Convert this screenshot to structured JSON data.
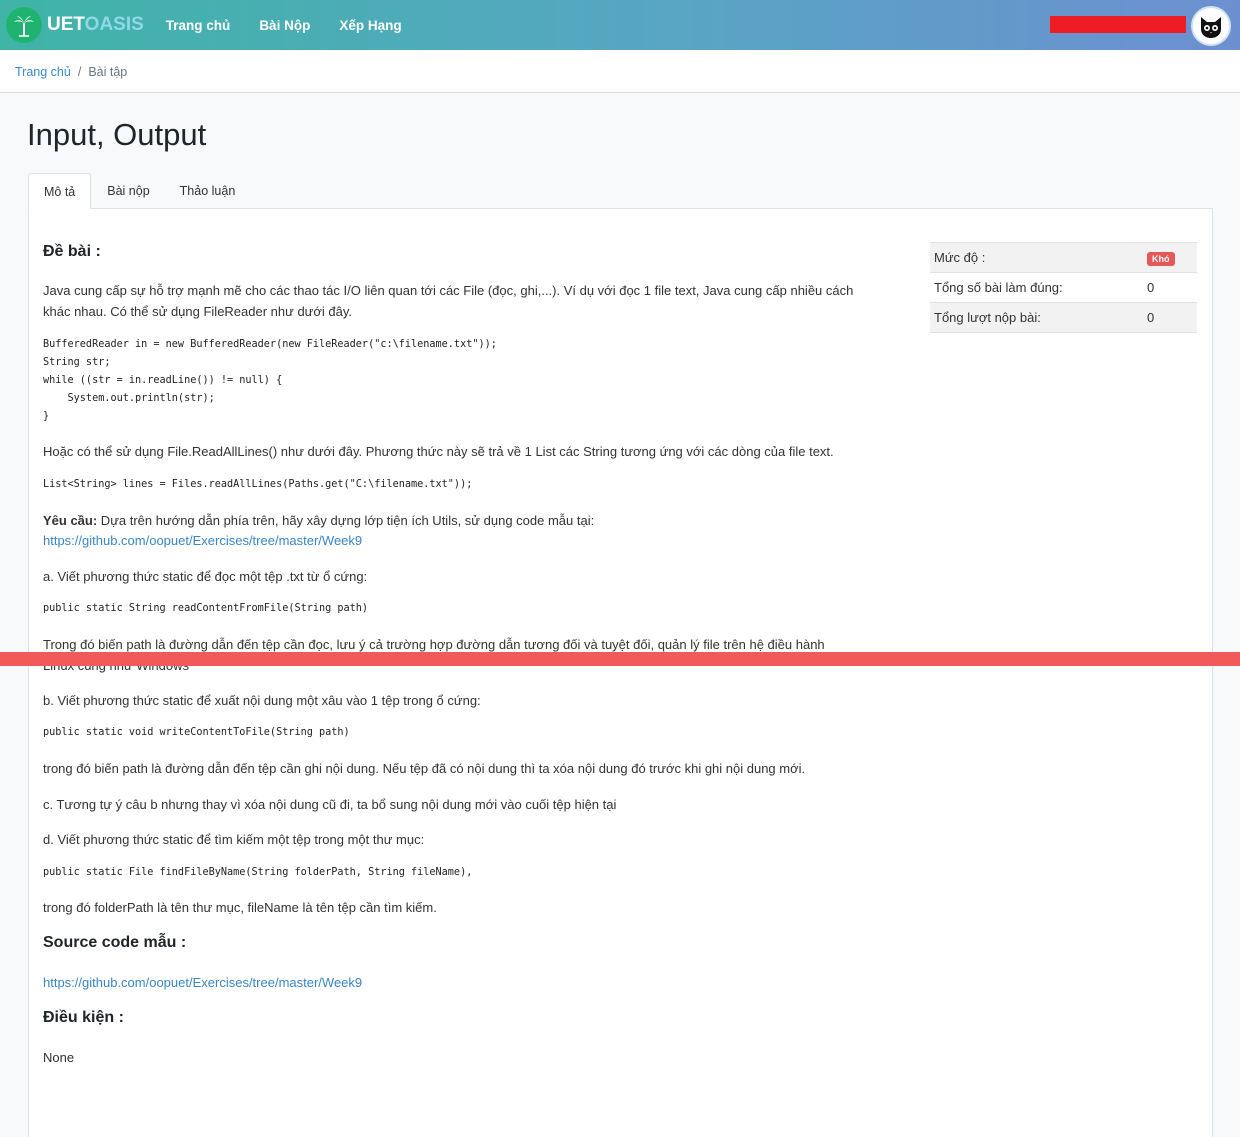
{
  "nav": {
    "brand_part1": "UET",
    "brand_part2": "OASIS",
    "links": [
      "Trang chủ",
      "Bài Nộp",
      "Xếp Hạng"
    ]
  },
  "breadcrumb": {
    "home": "Trang chủ",
    "separator": "/",
    "current": "Bài tập"
  },
  "page_title": "Input, Output",
  "tabs": [
    "Mô tả",
    "Bài nộp",
    "Thảo luận"
  ],
  "problem": {
    "heading_statement": "Đề bài :",
    "intro_line1": "Java cung cấp sự hỗ trợ mạnh mẽ cho các thao tác I/O liên quan tới các File (đọc, ghi,...). Ví dụ với đọc 1 file text, Java cung cấp nhiều cách",
    "intro_line2": "khác nhau. Có thể sử dụng FileReader như dưới đây.",
    "code1": "BufferedReader in = new BufferedReader(new FileReader(\"c:\\filename.txt\"));\nString str;\nwhile ((str = in.readLine()) != null) {\n    System.out.println(str);\n}",
    "alt_text": "Hoặc có thể sử dụng File.ReadAllLines() như dưới đây. Phương thức này sẽ trả về 1 List các String tương ứng với các dòng của file text.",
    "code2": "List<String> lines = Files.readAllLines(Paths.get(\"C:\\filename.txt\"));",
    "req_label": "Yêu cầu:",
    "req_text": " Dựa trên hướng dẫn phía trên, hãy xây dựng lớp tiện ích Utils, sử dụng code mẫu tại:",
    "req_link": "https://github.com/oopuet/Exercises/tree/master/Week9",
    "a_text": "a. Viết phương thức static để đọc một tệp .txt từ ổ cứng:",
    "a_code": "public static String readContentFromFile(String path)",
    "a_note_line1": "Trong đó biến path là đường dẫn đến tệp cần đọc, lưu ý cả trường hợp đường dẫn tương đối và tuyệt đối, quản lý file trên hệ điều hành",
    "a_note_line2": "Linux cũng như Windows",
    "b_text": "b. Viết phương thức static để xuất nội dung một xâu vào 1 tệp trong ổ cứng:",
    "b_code": "public static void writeContentToFile(String path)",
    "b_note": "trong đó biến path là đường dẫn đến tệp cần ghi nội dung. Nếu tệp đã có nội dung thì ta xóa nội dung đó trước khi ghi nội dung mới.",
    "c_text": "c. Tương tự ý câu b nhưng thay vì xóa nội dung cũ đi, ta bổ sung nội dung mới vào cuối tệp hiện tại",
    "d_text": "d. Viết phương thức static để tìm kiếm một tệp trong một thư mục:",
    "d_code": "public static File findFileByName(String folderPath, String fileName),",
    "d_note": "trong đó folderPath là tên thư mục, fileName là tên tệp cần tìm kiếm.",
    "heading_source": "Source code mẫu :",
    "source_link": "https://github.com/oopuet/Exercises/tree/master/Week9",
    "heading_conditions": "Điều kiện :",
    "conditions": "None"
  },
  "side": {
    "difficulty_label": "Mức độ :",
    "difficulty_value": "Khó",
    "difficulty_color": "#e65757",
    "correct_label": "Tổng số bài làm đúng:",
    "correct_value": "0",
    "submissions_label": "Tổng lượt nộp bài:",
    "submissions_value": "0"
  },
  "colors": {
    "nav_start": "#3fb4a7",
    "nav_end": "#6d8fd0",
    "link": "#3a86c4",
    "redaction": "#ee1c25",
    "overlay_line": "#f25a5a"
  }
}
